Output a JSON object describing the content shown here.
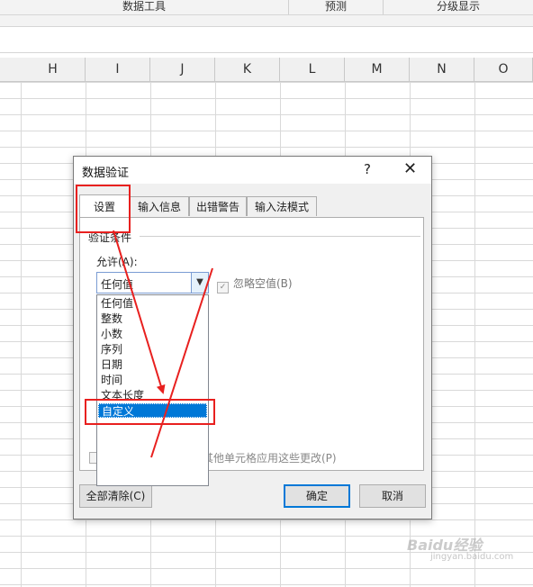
{
  "ribbon": {
    "groups": [
      "数据工具",
      "预测",
      "分级显示"
    ]
  },
  "sheet": {
    "columns": [
      "H",
      "I",
      "J",
      "K",
      "L",
      "M",
      "N",
      "O"
    ]
  },
  "dialog": {
    "title": "数据验证",
    "help": "?",
    "close": "✕",
    "tabs": [
      "设置",
      "输入信息",
      "出错警告",
      "输入法模式"
    ],
    "active_tab": "设置",
    "group_label": "验证条件",
    "allow_label": "允许(A):",
    "allow_value": "任何值",
    "ignore_blank": "忽略空值(B)",
    "options": [
      "任何值",
      "整数",
      "小数",
      "序列",
      "日期",
      "时间",
      "文本长度",
      "自定义"
    ],
    "selected_option": "自定义",
    "apply_all": "对有同样设置的所有其他单元格应用这些更改(P)",
    "buttons": {
      "clear_all": "全部清除(C)",
      "ok": "确定",
      "cancel": "取消"
    }
  },
  "watermark": {
    "brand": "Baidu经验",
    "url": "jingyan.baidu.com"
  },
  "colors": {
    "highlight": "#e8201f",
    "accent": "#0078d7"
  }
}
